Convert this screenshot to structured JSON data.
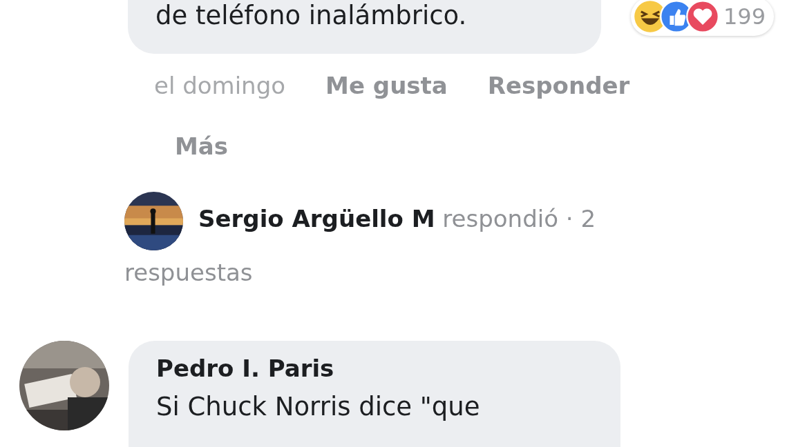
{
  "comment": {
    "text": "de teléfono inalámbrico.",
    "reaction_count": "199",
    "time": "el domingo",
    "actions": [
      "Me gusta",
      "Responder",
      "Más"
    ]
  },
  "reply_summary": {
    "text": "**Sergio Argüello M** respondió · 2 respuestas"
  },
  "next_comment": {
    "author": "Pedro I. Paris",
    "text": "Si Chuck Norris dice \"que"
  }
}
